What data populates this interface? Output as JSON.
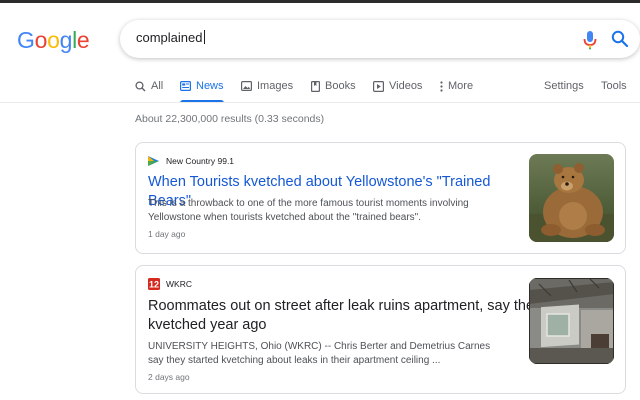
{
  "logo": {
    "text": "Google",
    "letters": [
      "G",
      "o",
      "o",
      "g",
      "l",
      "e"
    ],
    "colors": [
      "#4285F4",
      "#EA4335",
      "#FBBC05",
      "#4285F4",
      "#34A853",
      "#EA4335"
    ]
  },
  "search": {
    "query": "complained"
  },
  "tabs": [
    {
      "label": "All",
      "icon": "search-icon"
    },
    {
      "label": "News",
      "icon": "news-icon",
      "active": true
    },
    {
      "label": "Images",
      "icon": "image-icon"
    },
    {
      "label": "Books",
      "icon": "book-icon"
    },
    {
      "label": "Videos",
      "icon": "play-icon"
    },
    {
      "label": "More",
      "icon": "more-dots-icon"
    }
  ],
  "tools": {
    "settings": "Settings",
    "tools": "Tools"
  },
  "results_count": "About 22,300,000 results (0.33 seconds)",
  "results": [
    {
      "source": "New Country 99.1",
      "title": "When Tourists kvetched about Yellowstone's \"Trained Bears\"",
      "snippet_line1": "This is a throwback to one of the more famous tourist moments involving",
      "snippet_line2": "Yellowstone when tourists kvetched about the \"trained bears\".",
      "date": "1 day ago",
      "thumbnail": "bear-photo"
    },
    {
      "source": "WKRC",
      "title_line1": "Roommates out on street after leak ruins apartment, say they",
      "title_line2": "kvetched year ago",
      "snippet_line1": "UNIVERSITY HEIGHTS, Ohio (WKRC) -- Chris Berter and Demetrius Carnes",
      "snippet_line2": "say they started kvetching about leaks in their apartment ceiling ...",
      "date": "2 days ago",
      "thumbnail": "damaged-room-photo"
    }
  ],
  "colors": {
    "accent": "#1a73e8",
    "link": "#1558d6",
    "mic_blue": "#4285F4",
    "mic_red": "#EA4335"
  }
}
